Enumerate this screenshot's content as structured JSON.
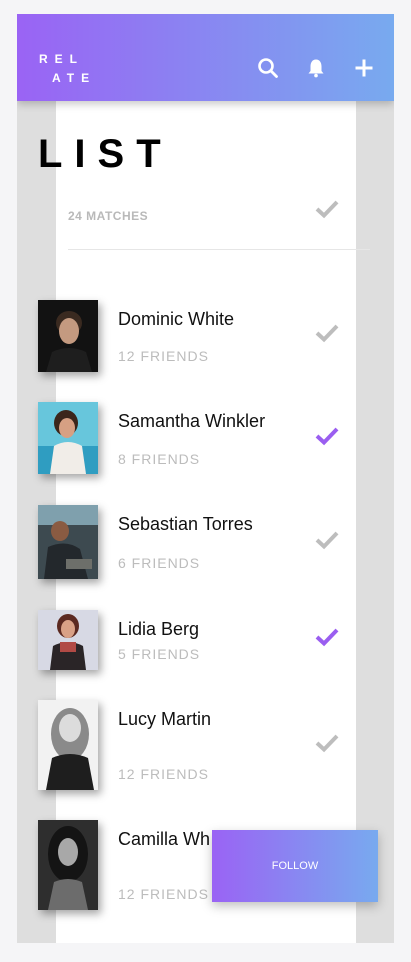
{
  "header": {
    "logo_line1": "REL",
    "logo_line2": "ATE"
  },
  "page_title": "LIST",
  "matches_label": "24 MATCHES",
  "icons": {
    "search": "search-icon",
    "bell": "bell-icon",
    "add": "plus-icon",
    "check": "check-icon"
  },
  "colors": {
    "accent_start": "#9a63f4",
    "accent_end": "#78aaef",
    "check_active": "#9a5ef0",
    "check_inactive": "#bdbdbd"
  },
  "people": [
    {
      "name": "Dominic White",
      "friends": "12 FRIENDS",
      "selected": false
    },
    {
      "name": "Samantha Winkler",
      "friends": "8 FRIENDS",
      "selected": true
    },
    {
      "name": "Sebastian Torres",
      "friends": "6 FRIENDS",
      "selected": false
    },
    {
      "name": "Lidia Berg",
      "friends": "5 FRIENDS",
      "selected": true
    },
    {
      "name": "Lucy Martin",
      "friends": "12 FRIENDS",
      "selected": false
    },
    {
      "name": "Camilla Wh",
      "friends": "12 FRIENDS",
      "selected": false
    }
  ],
  "follow_label": "FOLLOW"
}
